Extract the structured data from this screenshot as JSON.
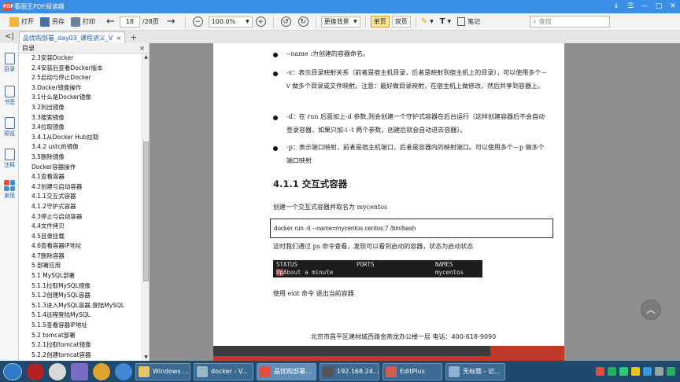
{
  "window": {
    "title": "看图王PDF阅读器",
    "controls": [
      "—",
      "□",
      "✕"
    ],
    "extra_icons": [
      "↓",
      "☰"
    ]
  },
  "toolbar": {
    "open_label": "打开",
    "saveas_label": "另存",
    "print_label": "打印",
    "page_current": "18",
    "page_total": "/28页",
    "zoom_value": "100.0%",
    "background_label": "更换背景",
    "single_page_label": "单页",
    "double_page_label": "双页",
    "notes_label": "笔记",
    "search_placeholder": "查找"
  },
  "tabs": {
    "active_label": "品优购部署_day03_课程讲义_V",
    "close": "×",
    "add": "+"
  },
  "leftstrip": {
    "items": [
      {
        "label": "目录"
      },
      {
        "label": "书签"
      },
      {
        "label": "预览"
      },
      {
        "label": "注释"
      },
      {
        "label": "发现"
      }
    ]
  },
  "toc": {
    "header": "目录",
    "close": "×",
    "items": [
      "2.3安装Docker",
      "2.4安装后查看Docker版本",
      "2.5启动与停止Docker",
      "3.Docker镜像操作",
      "3.1什么是Docker镜像",
      "3.2列出镜像",
      "3.3搜索镜像",
      "3.4拉取镜像",
      "3.4.1从Docker Hub拉取",
      "3.4.2 ustc的镜像",
      "3.5删除镜像",
      "Docker容器操作",
      "4.1查看容器",
      "4.2创建与启动容器",
      "4.1.1交互式容器",
      "4.1.2守护式容器",
      "4.3停止与启动容器",
      "4.4文件拷贝",
      "4.5目录挂载",
      "4.6查看容器IP地址",
      "4.7删除容器",
      "5.部署应用",
      "5.1 MySQL部署",
      "5.1.1拉取MySQL镜像",
      "5.1.2创建MySQL容器",
      "5.1.3进入MySQL容器,登陆MySQL",
      "5.1.4远程登陆MySQL",
      "5.1.5查看容器IP地址",
      "5.2 tomcat部署",
      "5.2.1拉取tomcat镜像",
      "5.2.2创建tomcat容器"
    ],
    "indent": [
      1,
      1,
      1,
      1,
      1,
      1,
      1,
      1,
      1,
      1,
      1,
      1,
      1,
      1,
      1,
      1,
      1,
      1,
      1,
      1,
      1,
      1,
      1,
      1,
      1,
      1,
      1,
      1,
      1,
      1,
      1
    ]
  },
  "document": {
    "bullets": [
      "--name :为创建的容器命名。",
      "-v：表示目录映射关系（前者是宿主机目录，后者是映射到宿主机上的目录），可以使用多个－v 做多个目录或文件映射。注意：最好做目录映射，在宿主机上做修改，然后共享到容器上。",
      "-d：在 run 后面加上-d 参数,则会创建一个守护式容器在后台运行（这样创建容器后不会自动登录容器，如果只加-i -t 两个参数，创建后就会自动进去容器）。",
      "-p：表示端口映射，前者是宿主机端口，后者是容器内的映射端口。可以使用多个－p 做多个端口映射"
    ],
    "heading": "4.1.1 交互式容器",
    "intro": "创建一个交互式容器并取名为 mycentos",
    "command": "docker run -it --name=mycentos centos:7 /bin/bash",
    "after_command": "这时我们通过 ps 命令查看，发现可以看到启动的容器，状态为启动状态",
    "terminal": {
      "col_status": "STATUS",
      "col_ports": "PORTS",
      "col_names": "NAMES",
      "status_up": "Up",
      "status_rest": " About a minute",
      "name_value": "mycentos"
    },
    "exit_text": "使用 exit 命令 退出当前容器",
    "footer": "北京市昌平区建材城西路金燕龙办公楼一层      电话：400-618-9090"
  },
  "taskbar": {
    "tasks": [
      "Windows ...",
      "docker - V...",
      "品优购部署...",
      "192.168.24...",
      "EditPlus",
      "无标题 - 记..."
    ]
  }
}
